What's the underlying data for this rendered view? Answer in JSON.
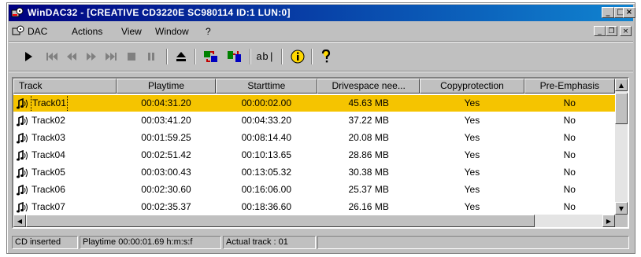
{
  "window": {
    "title": "WinDAC32 - [CREATIVE CD3220E SC980114  ID:1  LUN:0]",
    "controls": {
      "minimize": "_",
      "maximize": "□",
      "close": "×"
    }
  },
  "menubar": {
    "items": [
      "DAC",
      "Actions",
      "View",
      "Window",
      "?"
    ],
    "mdi_controls": {
      "minimize": "_",
      "restore": "❐",
      "close": "×"
    }
  },
  "toolbar": {
    "buttons": [
      "play-icon",
      "skip-first-icon",
      "rewind-icon",
      "fast-forward-icon",
      "skip-last-icon",
      "stop-icon",
      "pause-icon",
      "eject-icon",
      "copy-tracks-icon",
      "copy-selected-icon",
      "rename-icon",
      "info-icon",
      "help-icon"
    ],
    "rename_text": "ab|"
  },
  "table": {
    "columns": [
      "Track",
      "Playtime",
      "Starttime",
      "Drivespace nee...",
      "Copyprotection",
      "Pre-Emphasis"
    ],
    "rows": [
      {
        "track": "Track01",
        "playtime": "00:04:31.20",
        "starttime": "00:00:02.00",
        "drivespace": "45.63 MB",
        "copyprotection": "Yes",
        "preemphasis": "No"
      },
      {
        "track": "Track02",
        "playtime": "00:03:41.20",
        "starttime": "00:04:33.20",
        "drivespace": "37.22 MB",
        "copyprotection": "Yes",
        "preemphasis": "No"
      },
      {
        "track": "Track03",
        "playtime": "00:01:59.25",
        "starttime": "00:08:14.40",
        "drivespace": "20.08 MB",
        "copyprotection": "Yes",
        "preemphasis": "No"
      },
      {
        "track": "Track04",
        "playtime": "00:02:51.42",
        "starttime": "00:10:13.65",
        "drivespace": "28.86 MB",
        "copyprotection": "Yes",
        "preemphasis": "No"
      },
      {
        "track": "Track05",
        "playtime": "00:03:00.43",
        "starttime": "00:13:05.32",
        "drivespace": "30.38 MB",
        "copyprotection": "Yes",
        "preemphasis": "No"
      },
      {
        "track": "Track06",
        "playtime": "00:02:30.60",
        "starttime": "00:16:06.00",
        "drivespace": "25.37 MB",
        "copyprotection": "Yes",
        "preemphasis": "No"
      },
      {
        "track": "Track07",
        "playtime": "00:02:35.37",
        "starttime": "00:18:36.60",
        "drivespace": "26.16 MB",
        "copyprotection": "Yes",
        "preemphasis": "No"
      }
    ],
    "selected_index": 0
  },
  "statusbar": {
    "panels": [
      "CD inserted",
      "Playtime 00:00:01.69 h:m:s:f",
      "Actual track : 01"
    ]
  },
  "colors": {
    "titlebar_start": "#000080",
    "titlebar_end": "#1084d0",
    "selection": "#f5c400",
    "face": "#c0c0c0"
  }
}
